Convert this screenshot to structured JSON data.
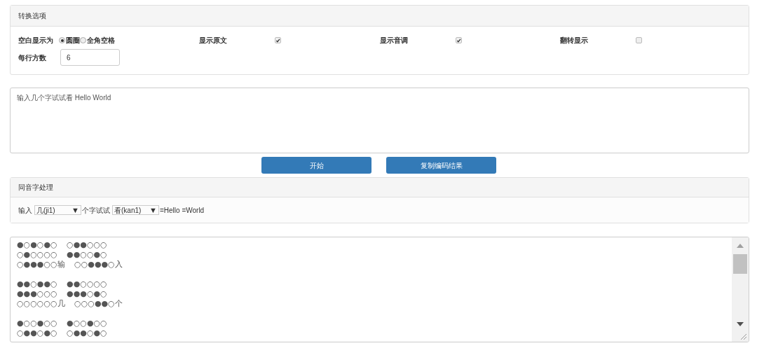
{
  "options_panel": {
    "title": "转换选项",
    "blank_display": {
      "label": "空白显示为",
      "choices": [
        {
          "label": "圆圈",
          "selected": true
        },
        {
          "label": "全角空格",
          "selected": false
        }
      ]
    },
    "toggles": [
      {
        "label": "显示原文",
        "checked": true
      },
      {
        "label": "显示音调",
        "checked": true
      },
      {
        "label": "翻转显示",
        "checked": false
      }
    ],
    "per_line": {
      "label": "每行方数",
      "value": "6"
    }
  },
  "input": {
    "value": "输入几个字试试看 Hello World"
  },
  "buttons": [
    "开始",
    "复制编码结果"
  ],
  "homophone_panel": {
    "title": "同音字处理",
    "parts": [
      {
        "kind": "text",
        "text": "输入"
      },
      {
        "kind": "select",
        "value": "几(ji1)",
        "arrow": "▼"
      },
      {
        "kind": "text",
        "text": "个字试试"
      },
      {
        "kind": "select",
        "value": "看(kan1)",
        "arrow": "▼"
      },
      {
        "kind": "text",
        "text": "=Hello =World"
      }
    ]
  },
  "output": {
    "groups": [
      {
        "lines": [
          "●○●○●○ ○●●○○○",
          "○●○○○○ ●●○○●○",
          "○●●●○○输 ○○●●●○入"
        ]
      },
      {
        "lines": [
          "●●○●●○ ●●○○○○",
          "●●●○○○ ●●●○●○",
          "○○○○○○几 ○○○●●○个"
        ]
      },
      {
        "lines": [
          "●○○●○○ ●○○●○○",
          "○●●○●○ ○●●○●○"
        ]
      }
    ]
  }
}
